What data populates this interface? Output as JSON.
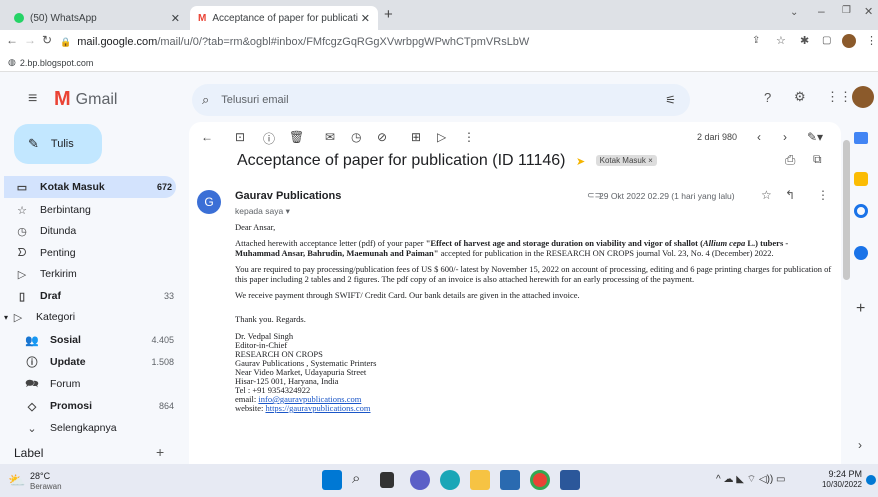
{
  "browser": {
    "tabs": [
      {
        "title": "(50) WhatsApp",
        "active": false
      },
      {
        "title": "Acceptance of paper for publicati",
        "active": true
      }
    ],
    "new_tab": "+",
    "url_host": "mail.google.com",
    "url_path": "/mail/u/0/?tab=rm&ogbl#inbox/FMfcgzGqRGgXVwrbpgWPwhCTpmVRsLbW",
    "status_link": "2.bp.blogspot.com"
  },
  "gmail": {
    "logo": "Gmail",
    "compose": "Tulis",
    "search_placeholder": "Telusuri email",
    "nav": [
      {
        "label": "Kotak Masuk",
        "count": "672",
        "icon": "inbox-icon",
        "bold": true
      },
      {
        "label": "Berbintang",
        "count": "",
        "icon": "star-icon",
        "bold": false
      },
      {
        "label": "Ditunda",
        "count": "",
        "icon": "clock-icon",
        "bold": false
      },
      {
        "label": "Penting",
        "count": "",
        "icon": "important-icon",
        "bold": false
      },
      {
        "label": "Terkirim",
        "count": "",
        "icon": "send-icon",
        "bold": false
      },
      {
        "label": "Draf",
        "count": "33",
        "icon": "draft-icon",
        "bold": true
      },
      {
        "label": "Kategori",
        "count": "",
        "icon": "label-icon",
        "bold": false
      },
      {
        "label": "Sosial",
        "count": "4.405",
        "icon": "people-icon",
        "bold": true
      },
      {
        "label": "Update",
        "count": "1.508",
        "icon": "info-icon",
        "bold": true
      },
      {
        "label": "Forum",
        "count": "",
        "icon": "forum-icon",
        "bold": false
      },
      {
        "label": "Promosi",
        "count": "864",
        "icon": "tag-icon",
        "bold": true
      },
      {
        "label": "Selengkapnya",
        "count": "",
        "icon": "chevron-down-icon",
        "bold": false
      }
    ],
    "labels_heading": "Label",
    "pagination": "2 dari 980"
  },
  "email": {
    "subject": "Acceptance of paper for publication (ID 11146)",
    "label_chip": "Kotak Masuk ×",
    "sender": "Gaurav Publications",
    "sender_initial": "G",
    "to": "kepada saya ▾",
    "date": "29 Okt 2022 02.29 (1 hari yang lalu)",
    "greeting": "Dear Ansar,",
    "p1_pre": "Attached herewith acceptance letter (pdf) of your paper ",
    "p1_title": "\"Effect of harvest age and storage duration on viability and vigor of shallot (",
    "p1_species": "Allium cepa",
    "p1_title2": " L.) tubers - Muhammad Ansar, Bahrudin, Maemunah and Paiman\"",
    "p1_post": " accepted for publication in the RESEARCH ON CROPS journal Vol. 23, No. 4 (December) 2022.",
    "p2": "You are required to pay processing/publication fees of  US $ 600/- latest by November 15, 2022 on account of processing, editing and 6 page printing charges for publication of this paper including 2 tables and 2 figures. The pdf copy of an invoice is also attached herewith for an early processing of the payment.",
    "p3": "We receive payment through SWIFT/ Credit Card. Our bank details are given in the attached invoice.",
    "thanks": "Thank you. Regards.",
    "sig": [
      "Dr. Vedpal Singh",
      "Editor-in-Chief",
      "RESEARCH ON CROPS",
      "Gaurav Publications , Systematic Printers",
      "Near Video Market, Udayapuria Street",
      "Hisar-125 001, Haryana, India",
      "Tel : +91 9354324922"
    ],
    "email_label": "email: ",
    "email_link": "info@gauravpublications.com",
    "web_label": "website: ",
    "web_link": "https://gauravpublications.com"
  },
  "taskbar": {
    "weather_temp": "28°C",
    "weather_text": "Berawan",
    "time": "9:24 PM",
    "date": "10/30/2022"
  },
  "colors": {
    "gmail_red": "#ea4335",
    "accent": "#c2e7ff",
    "taskbar": "#e7eaf3"
  }
}
